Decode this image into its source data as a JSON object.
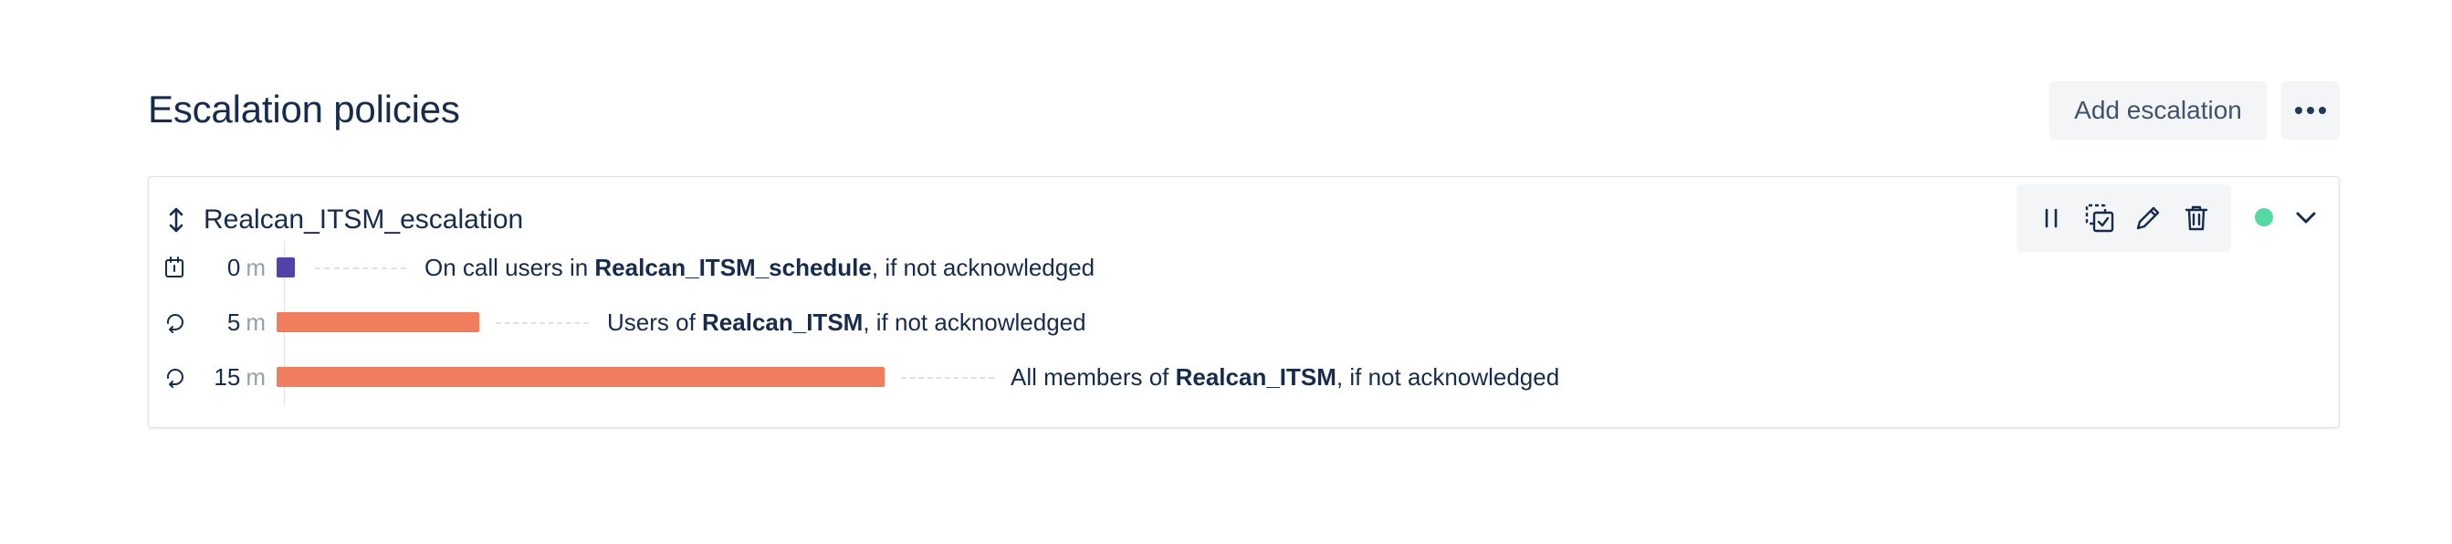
{
  "header": {
    "title": "Escalation policies",
    "add_button": "Add escalation"
  },
  "policy": {
    "name": "Realcan_ITSM_escalation",
    "status_color": "#57d9a3",
    "steps": [
      {
        "icon": "schedule-icon",
        "time": "0",
        "unit": "m",
        "bar_color": "#5243aa",
        "prefix": "On call users in ",
        "target": "Realcan_ITSM_schedule",
        "suffix": ", if not acknowledged"
      },
      {
        "icon": "team-icon",
        "time": "5",
        "unit": "m",
        "bar_color": "#f07d5e",
        "prefix": "Users of ",
        "target": "Realcan_ITSM",
        "suffix": ", if not acknowledged"
      },
      {
        "icon": "team-icon",
        "time": "15",
        "unit": "m",
        "bar_color": "#f07d5e",
        "prefix": "All members of ",
        "target": "Realcan_ITSM",
        "suffix": ", if not acknowledged"
      }
    ]
  }
}
